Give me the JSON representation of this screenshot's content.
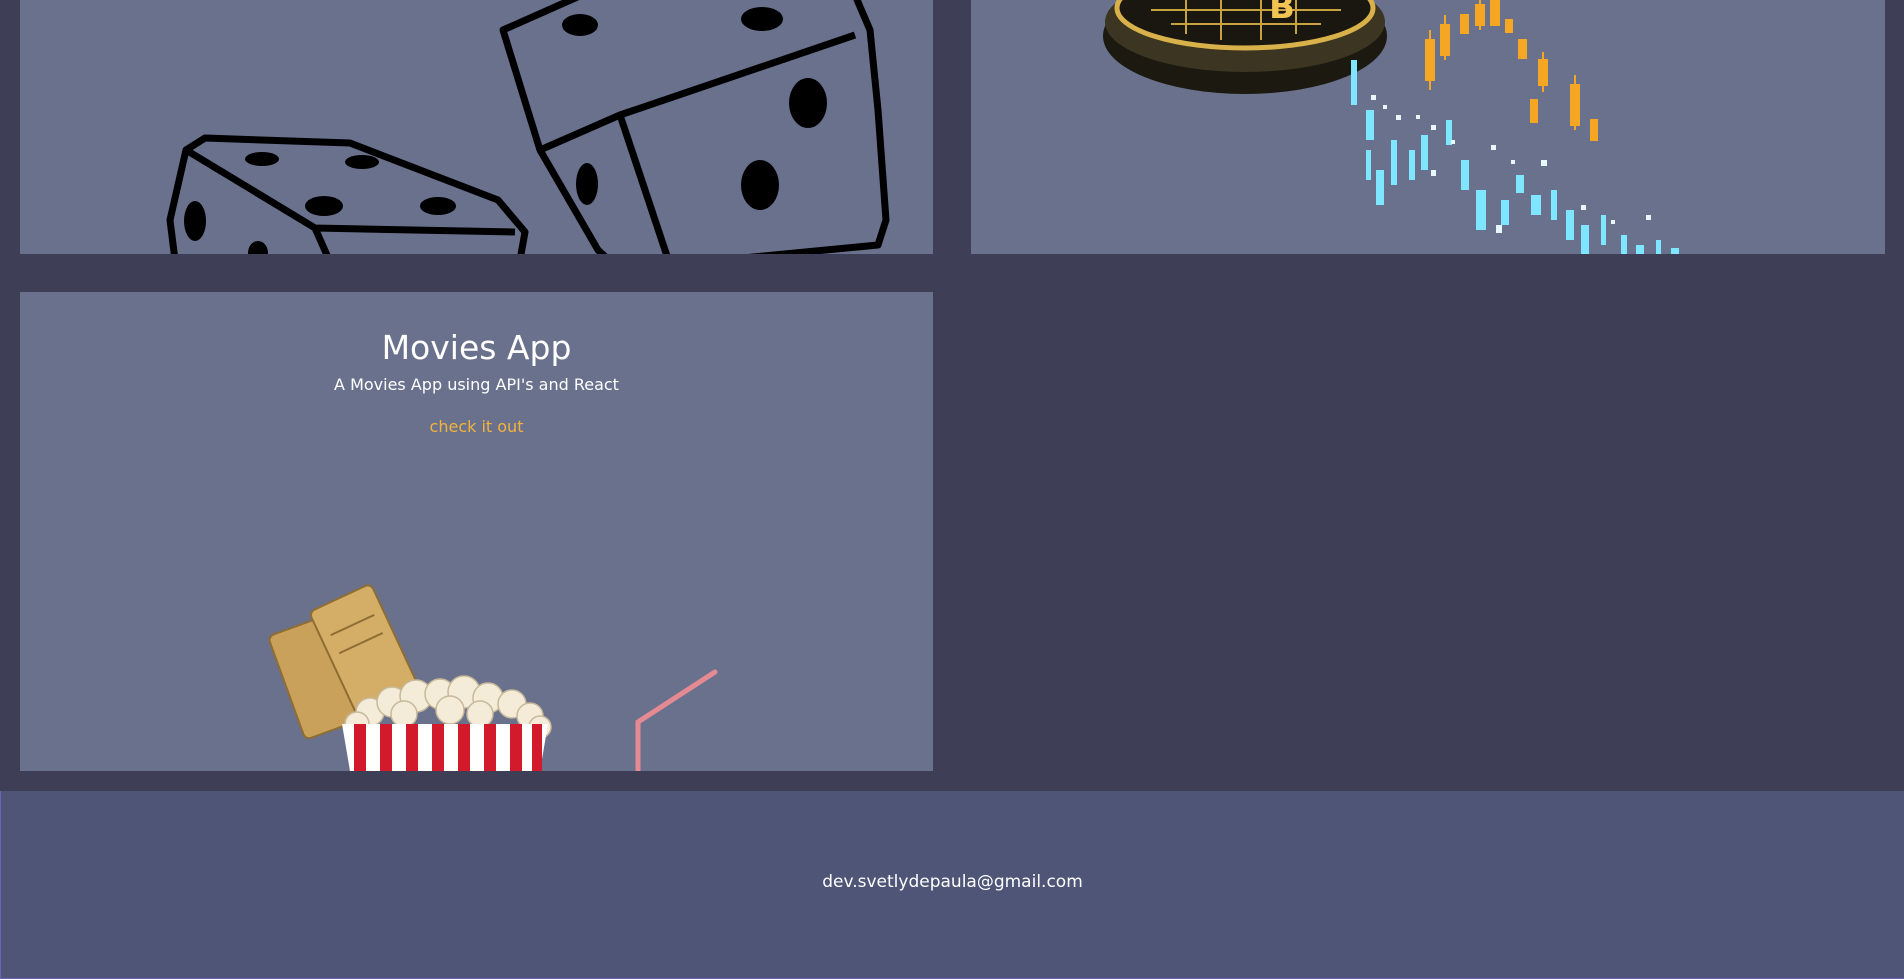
{
  "projects": [
    {
      "image": "dice-illustration"
    },
    {
      "image": "bitcoin-candlestick-illustration"
    },
    {
      "title": "Movies App",
      "description": "A Movies App using API's and React",
      "link_label": "check it out",
      "image": "popcorn-tickets-illustration"
    }
  ],
  "footer": {
    "email": "dev.svetlydepaula@gmail.com"
  },
  "colors": {
    "page_background": "#3e3f56",
    "card_background": "#6a718d",
    "footer_background": "#4f5577",
    "link_accent": "#f2b33d"
  }
}
